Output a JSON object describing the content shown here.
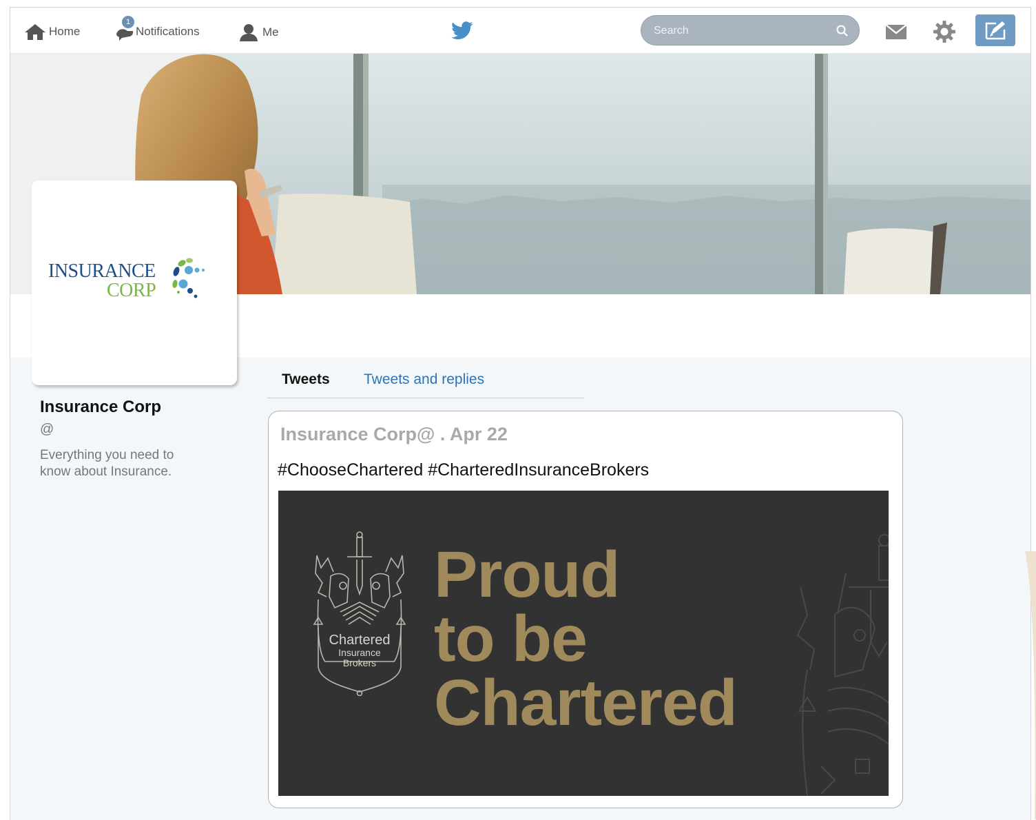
{
  "nav": {
    "home_label": "Home",
    "notifications_label": "Notifications",
    "notifications_count": "1",
    "me_label": "Me",
    "search_placeholder": "Search"
  },
  "profile": {
    "logo_line1": "INSURANCE",
    "logo_line2": "CORP",
    "name": "Insurance Corp",
    "handle": "@",
    "bio": "Everything you need to know about Insurance."
  },
  "tabs": [
    {
      "label": "Tweets",
      "active": true
    },
    {
      "label": "Tweets and replies",
      "active": false
    }
  ],
  "tweet": {
    "header": "Insurance Corp@ . Apr 22",
    "hashtags": "#ChooseChartered  #CharteredInsuranceBrokers",
    "image": {
      "crest_line1": "Chartered",
      "crest_line2": "Insurance",
      "crest_line3": "Brokers",
      "headline_1": "Proud",
      "headline_2": "to be",
      "headline_3": "Chartered"
    }
  },
  "colors": {
    "twitter_blue": "#4a90c8",
    "compose_bg": "#6f9ac4",
    "tab_link": "#2b74b5",
    "gold": "#a08a5b",
    "image_bg": "#333232",
    "logo_blue": "#1d4e8b",
    "logo_green": "#7ab648"
  },
  "icons": [
    "home-icon",
    "notifications-icon",
    "me-icon",
    "twitter-bird-icon",
    "search-icon",
    "mail-icon",
    "gear-icon",
    "compose-icon"
  ]
}
